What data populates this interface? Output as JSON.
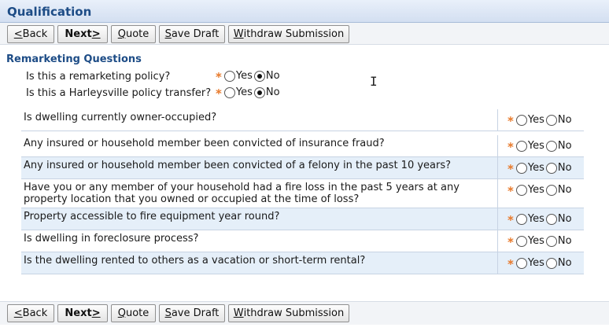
{
  "window": {
    "title": "Qualification"
  },
  "toolbar": {
    "back_hotkey": "<",
    "back_label": " Back",
    "next_label": "Next ",
    "next_hotkey": ">",
    "quote_hotkey": "Q",
    "quote_label": "uote",
    "save_hotkey": "S",
    "save_label": "ave Draft",
    "withdraw_hotkey": "W",
    "withdraw_label": "ithdraw Submission"
  },
  "section": {
    "title": "Remarketing Questions"
  },
  "remarketing": [
    {
      "question": "Is this a remarketing policy?",
      "yes": "Yes",
      "no": "No",
      "selected": "No"
    },
    {
      "question": "Is this a Harleysville policy transfer?",
      "yes": "Yes",
      "no": "No",
      "selected": "No"
    }
  ],
  "required_marker": "*",
  "questions": [
    {
      "text": "Is dwelling currently owner-occupied?",
      "yes": "Yes",
      "no": "No",
      "selected": ""
    },
    {
      "text": "Any insured or household member been convicted of insurance fraud?",
      "yes": "Yes",
      "no": "No",
      "selected": ""
    },
    {
      "text": "Any insured or household member been convicted of a felony in the past 10 years?",
      "yes": "Yes",
      "no": "No",
      "selected": ""
    },
    {
      "text": "Have you or any member of your household had a fire loss in the past 5 years at any property location that you owned or occupied at the time of loss?",
      "yes": "Yes",
      "no": "No",
      "selected": ""
    },
    {
      "text": "Property accessible to fire equipment year round?",
      "yes": "Yes",
      "no": "No",
      "selected": ""
    },
    {
      "text": "Is dwelling in foreclosure process?",
      "yes": "Yes",
      "no": "No",
      "selected": ""
    },
    {
      "text": "Is the dwelling rented to others as a vacation or short-term rental?",
      "yes": "Yes",
      "no": "No",
      "selected": ""
    }
  ]
}
